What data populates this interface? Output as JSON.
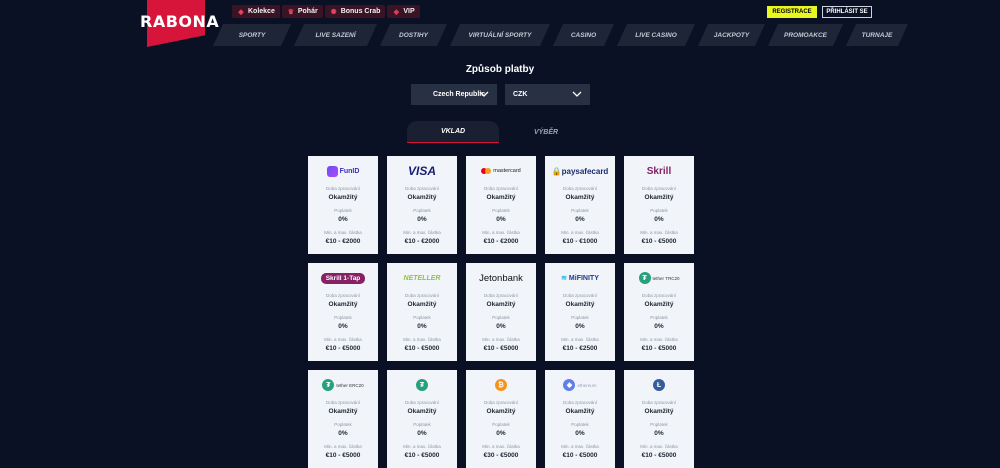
{
  "brand": {
    "logo_text": "RABONA"
  },
  "topbar": [
    {
      "icon": "gift-icon",
      "glyph": "◆",
      "label": "Kolekce"
    },
    {
      "icon": "trophy-icon",
      "glyph": "♛",
      "label": "Pohár"
    },
    {
      "icon": "bonus-crab-icon",
      "glyph": "✺",
      "label": "Bonus Crab"
    },
    {
      "icon": "vip-icon",
      "glyph": "◈",
      "label": "VIP"
    }
  ],
  "header": {
    "register_label": "REGISTRACE",
    "login_label": "PŘIHLÁSIT SE"
  },
  "nav": [
    "SPORTY",
    "LIVE SAZENÍ",
    "DOSTIHY",
    "VIRTUÁLNÍ SPORTY",
    "CASINO",
    "LIVE CASINO",
    "JACKPOTY",
    "PROMOAKCE",
    "TURNAJE"
  ],
  "page": {
    "title": "Způsob platby"
  },
  "filters": {
    "country": "Czech Republic",
    "currency": "CZK"
  },
  "tabs": {
    "deposit": "VKLAD",
    "withdraw": "VÝBĚR"
  },
  "labels": {
    "processing": "Doba zpracování",
    "fee": "Poplatek",
    "limits": "Min. a max. částka"
  },
  "colors": {
    "brand_red": "#d7153a",
    "accent_yellow": "#e8f71f",
    "background": "#0b1125"
  },
  "methods": [
    {
      "name": "FunID",
      "processing": "Okamžitý",
      "fee": "0%",
      "limits": "€10 - €2000"
    },
    {
      "name": "VISA",
      "processing": "Okamžitý",
      "fee": "0%",
      "limits": "€10 - €2000"
    },
    {
      "name": "mastercard",
      "processing": "Okamžitý",
      "fee": "0%",
      "limits": "€10 - €2000"
    },
    {
      "name": "paysafecard",
      "processing": "Okamžitý",
      "fee": "0%",
      "limits": "€10 - €1000"
    },
    {
      "name": "Skrill",
      "processing": "Okamžitý",
      "fee": "0%",
      "limits": "€10 - €5000"
    },
    {
      "name": "Skrill 1-Tap",
      "processing": "Okamžitý",
      "fee": "0%",
      "limits": "€10 - €5000"
    },
    {
      "name": "NETELLER",
      "processing": "Okamžitý",
      "fee": "0%",
      "limits": "€10 - €5000"
    },
    {
      "name": "Jetonbank",
      "processing": "Okamžitý",
      "fee": "0%",
      "limits": "€10 - €5000"
    },
    {
      "name": "MiFINITY",
      "processing": "Okamžitý",
      "fee": "0%",
      "limits": "€10 - €2500"
    },
    {
      "name": "tether TRC20",
      "processing": "Okamžitý",
      "fee": "0%",
      "limits": "€10 - €5000"
    },
    {
      "name": "tether ERC20",
      "processing": "Okamžitý",
      "fee": "0%",
      "limits": "€10 - €5000"
    },
    {
      "name": "tether",
      "processing": "Okamžitý",
      "fee": "0%",
      "limits": "€10 - €5000"
    },
    {
      "name": "bitcoin",
      "processing": "Okamžitý",
      "fee": "0%",
      "limits": "€30 - €5000"
    },
    {
      "name": "ethereum",
      "processing": "Okamžitý",
      "fee": "0%",
      "limits": "€10 - €5000"
    },
    {
      "name": "litecoin",
      "processing": "Okamžitý",
      "fee": "0%",
      "limits": "€10 - €5000"
    }
  ]
}
